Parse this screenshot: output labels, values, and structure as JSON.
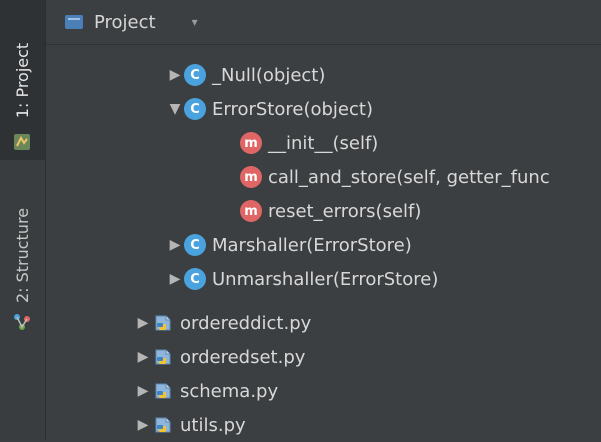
{
  "app": {
    "sidebar": {
      "tabs": [
        {
          "label": "1: Project",
          "active": true,
          "icon": "project-icon"
        },
        {
          "label": "2: Structure",
          "active": false,
          "icon": "structure-icon"
        }
      ]
    },
    "header": {
      "title": "Project",
      "icon": "project-folder-icon",
      "dropdown_icon": "dropdown-caret-icon"
    },
    "tree": {
      "items": [
        {
          "label": "_Null(object)",
          "kind": "class",
          "badge": "c",
          "expanded": false,
          "level": 2
        },
        {
          "label": "ErrorStore(object)",
          "kind": "class",
          "badge": "c",
          "expanded": true,
          "level": 2
        },
        {
          "label": "__init__(self)",
          "kind": "method",
          "badge": "m",
          "level": 3
        },
        {
          "label": "call_and_store(self, getter_func",
          "kind": "method",
          "badge": "m",
          "level": 3
        },
        {
          "label": "reset_errors(self)",
          "kind": "method",
          "badge": "m",
          "level": 3
        },
        {
          "label": "Marshaller(ErrorStore)",
          "kind": "class",
          "badge": "c",
          "expanded": false,
          "level": 2
        },
        {
          "label": "Unmarshaller(ErrorStore)",
          "kind": "class",
          "badge": "c",
          "expanded": false,
          "level": 2
        },
        {
          "label": "ordereddict.py",
          "kind": "file",
          "icon": "python-file-icon",
          "expanded": false,
          "level": 1
        },
        {
          "label": "orderedset.py",
          "kind": "file",
          "icon": "python-file-icon",
          "expanded": false,
          "level": 1
        },
        {
          "label": "schema.py",
          "kind": "file",
          "icon": "python-file-icon",
          "expanded": false,
          "level": 1
        },
        {
          "label": "utils.py",
          "kind": "file",
          "icon": "python-file-icon",
          "expanded": false,
          "level": 1
        }
      ]
    },
    "colors": {
      "background": "#3c3f41",
      "text": "#d8d8d8",
      "class_badge": "#4aa3df",
      "method_badge": "#e06666"
    }
  }
}
